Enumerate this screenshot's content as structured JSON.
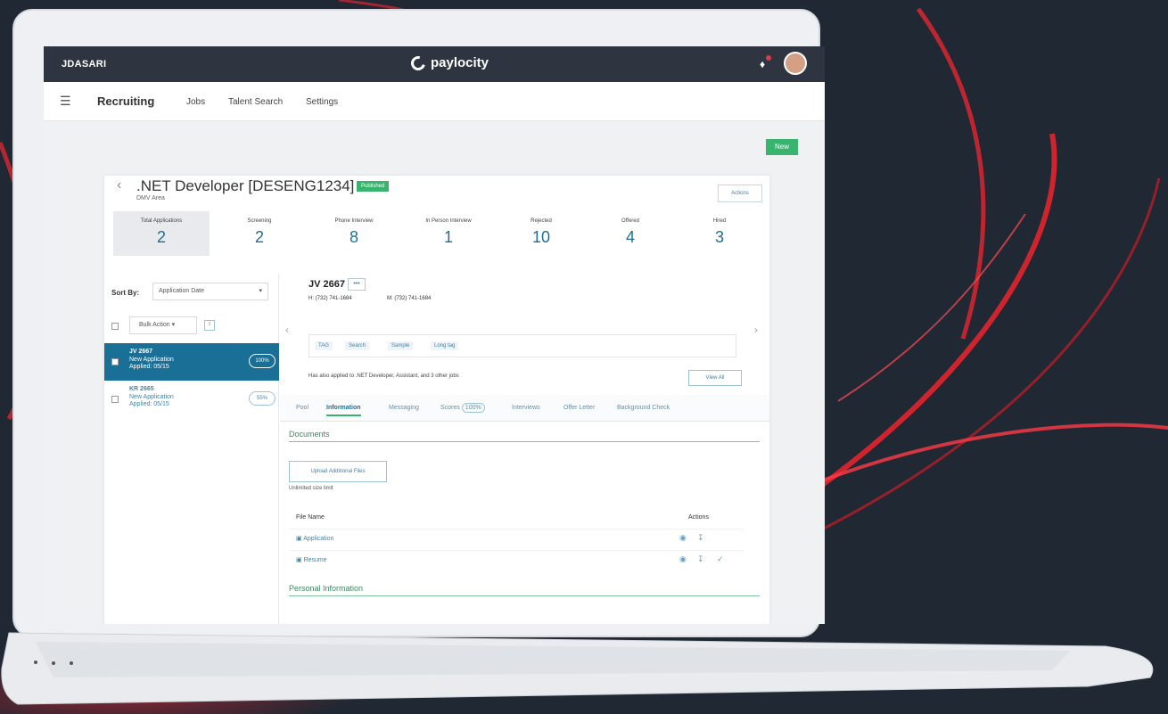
{
  "topbar": {
    "account": "JDASARI",
    "brand": "paylocity"
  },
  "nav": {
    "module": "Recruiting",
    "tabs": [
      "Jobs",
      "Talent Search",
      "Settings"
    ]
  },
  "new_button": "New",
  "job": {
    "title": ".NET Developer [DESENG1234]",
    "subtitle": "DMV Area",
    "status": "Published",
    "actions": "Actions"
  },
  "stats": [
    {
      "label": "Total Applications",
      "value": "2"
    },
    {
      "label": "Screening",
      "value": "2"
    },
    {
      "label": "Phone Interview",
      "value": "8"
    },
    {
      "label": "In Person Interview",
      "value": "1"
    },
    {
      "label": "Rejected",
      "value": "10"
    },
    {
      "label": "Offered",
      "value": "4"
    },
    {
      "label": "Hired",
      "value": "3"
    }
  ],
  "sort": {
    "label": "Sort By:",
    "selected": "Application Date",
    "bulk": "Bulk Action"
  },
  "candidates": [
    {
      "name": "JV 2667",
      "status": "New Application",
      "date": "Applied: 05/15",
      "match": "100%"
    },
    {
      "name": "KR 2665",
      "status": "New Application",
      "date": "Applied: 05/15",
      "match": "55%"
    }
  ],
  "detail": {
    "name": "JV 2667",
    "more": "•••",
    "phone_h": "H: (732) 741-1684",
    "phone_m": "M: (732) 741-1684",
    "tags": [
      "TAG",
      "Search",
      "Sample",
      "Long tag"
    ],
    "applied_note": "Has also applied to .NET Developer, Assistant, and 3 other jobs",
    "view_all": "View All",
    "tabs": [
      "Pool",
      "Information",
      "Messaging",
      "Scores",
      "Interviews",
      "Offer Letter",
      "Background Check"
    ],
    "score_badge": "100%",
    "documents_heading": "Documents",
    "upload_button": "Upload Additional Files",
    "upload_sub": "Unlimited size limit",
    "file_col": "File Name",
    "actions_col": "Actions",
    "files": [
      "Application",
      "Resume"
    ],
    "personal_heading": "Personal Information"
  }
}
